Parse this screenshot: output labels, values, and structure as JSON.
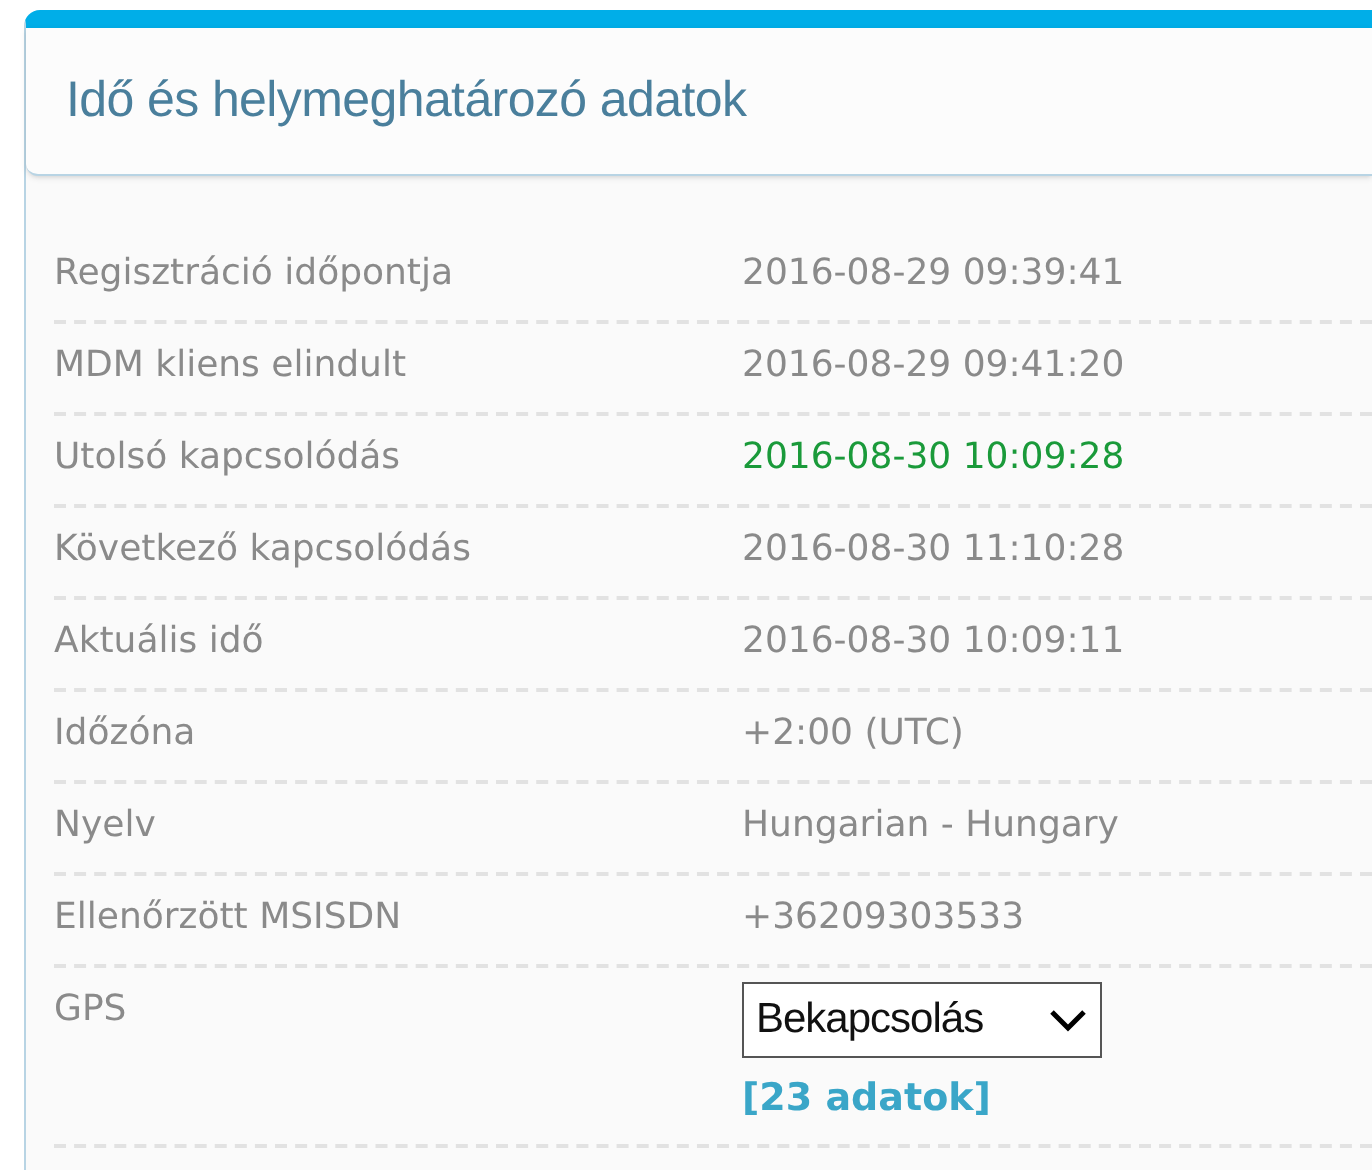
{
  "panel": {
    "title": "Idő és helymeghatározó adatok"
  },
  "rows": [
    {
      "kind": "text",
      "label": "Regisztráció időpontja",
      "value": "2016-08-29 09:39:41",
      "highlight": false
    },
    {
      "kind": "text",
      "label": "MDM kliens elindult",
      "value": "2016-08-29 09:41:20",
      "highlight": false
    },
    {
      "kind": "text",
      "label": "Utolsó kapcsolódás",
      "value": "2016-08-30 10:09:28",
      "highlight": true
    },
    {
      "kind": "text",
      "label": "Következő kapcsolódás",
      "value": "2016-08-30 11:10:28",
      "highlight": false
    },
    {
      "kind": "text",
      "label": "Aktuális idő",
      "value": "2016-08-30 10:09:11",
      "highlight": false
    },
    {
      "kind": "text",
      "label": "Időzóna",
      "value": "+2:00 (UTC)",
      "highlight": false
    },
    {
      "kind": "text",
      "label": "Nyelv",
      "value": "Hungarian - Hungary",
      "highlight": false
    },
    {
      "kind": "text",
      "label": "Ellenőrzött MSISDN",
      "value": "+36209303533",
      "highlight": false
    },
    {
      "kind": "select",
      "label": "GPS",
      "value": "Bekapcsolás",
      "link": "[23 adatok]"
    }
  ]
}
